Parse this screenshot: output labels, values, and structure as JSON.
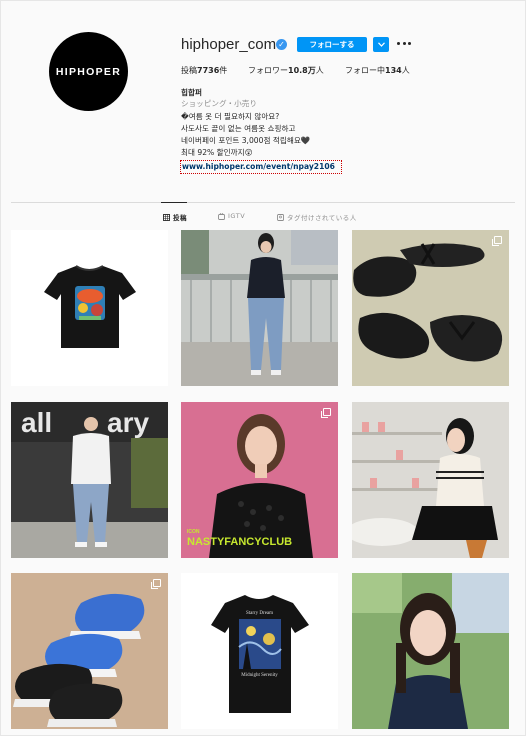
{
  "profile": {
    "logo_text": "HIPHOPER",
    "username": "hiphoper_com",
    "follow_label": "フォローする",
    "stats": {
      "posts_label": "投稿",
      "posts_value": "7736",
      "posts_unit": "件",
      "followers_label": "フォロワー",
      "followers_value": "10.8万",
      "followers_unit": "人",
      "following_label": "フォロー中",
      "following_value": "134",
      "following_unit": "人"
    },
    "display_name": "힙합퍼",
    "category": "ショッピング・小売り",
    "bio_lines": [
      "�여름 옷 더 필요하지 않아요?",
      "사도사도 끝이 없는 여름옷 쇼핑하고",
      "네이버페이 포인트 3,000점 적립해요🖤",
      "최대 92% 할인까지😲"
    ],
    "link": "www.hiphoper.com/event/npay2106"
  },
  "tabs": [
    {
      "label": "投稿",
      "active": true
    },
    {
      "label": "IGTV",
      "active": false
    },
    {
      "label": "タグ付けされている人",
      "active": false
    }
  ],
  "posts": [
    {
      "alt": "black t-shirt with graphic print",
      "multi": false
    },
    {
      "alt": "woman in black tee and jeans",
      "multi": false
    },
    {
      "alt": "black flip-flop sandals",
      "multi": true
    },
    {
      "alt": "man in white tee and jeans",
      "multi": false
    },
    {
      "alt": "woman in black lace top",
      "multi": true,
      "caption": "NASTYFANCYCLUB",
      "caption_small": "ICON"
    },
    {
      "alt": "woman in striped cardigan",
      "multi": false
    },
    {
      "alt": "blue and black sneakers",
      "multi": true
    },
    {
      "alt": "black tee with starry night print",
      "multi": false,
      "tee_top": "Starry Dream",
      "tee_bottom": "Midnight Serenity"
    },
    {
      "alt": "woman outdoors in navy top",
      "multi": false
    }
  ],
  "colors": {
    "accent": "#0095f6",
    "text": "#262626",
    "muted": "#8e8e8e",
    "link": "#00376b"
  }
}
